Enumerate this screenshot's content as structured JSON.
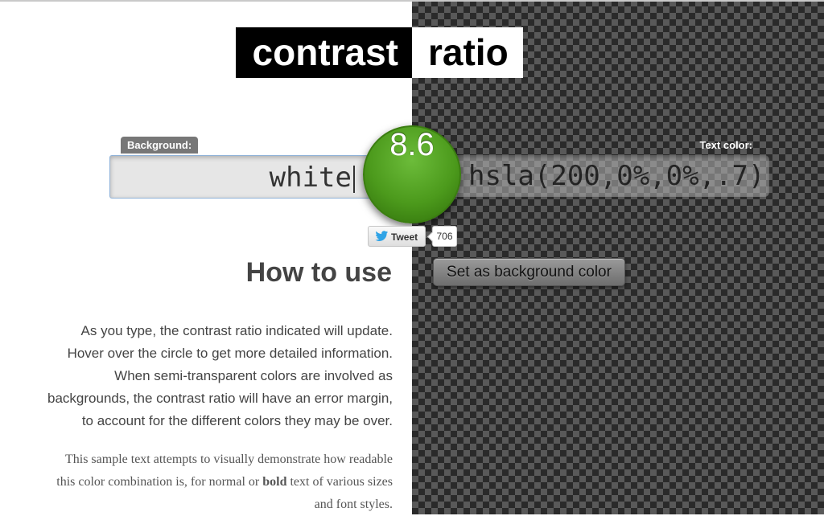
{
  "header": {
    "title_left": "contrast",
    "title_right": "ratio"
  },
  "background": {
    "label": "Background:",
    "value": "white"
  },
  "text_color": {
    "label": "Text color:",
    "value": "hsla(200,0%,0%,.7)"
  },
  "result": {
    "ratio": "8.6",
    "color": "#4c9a1c"
  },
  "tweet": {
    "label": "Tweet",
    "count": "706"
  },
  "actions": {
    "set_background_label": "Set as background color"
  },
  "how_to_use": {
    "heading": "How to use",
    "lines": [
      "As you type, the contrast ratio indicated will update.",
      "Hover over the circle to get more detailed information.",
      "When semi-transparent colors are involved as",
      "backgrounds, the contrast ratio will have an error margin,",
      "to account for the different colors they may be over."
    ]
  },
  "sample": {
    "line1": "This sample text attempts to visually demonstrate how readable",
    "line2_before": "this color combination is, for normal or ",
    "line2_bold": "bold",
    "line2_after": " text of various sizes",
    "line3": "and font styles."
  },
  "icons": {
    "tweet": "twitter-bird-icon"
  }
}
